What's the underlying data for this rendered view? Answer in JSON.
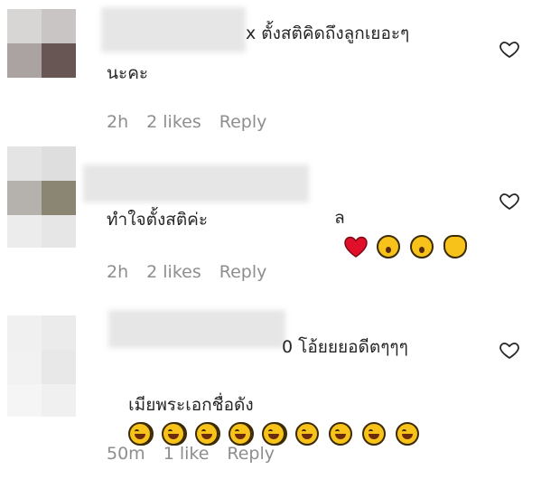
{
  "comments": [
    {
      "line1": "x ตั้งสติคิดถึงลูกเยอะๆ",
      "line2": "นะคะ",
      "time": "2h",
      "likes": "2 likes",
      "reply": "Reply"
    },
    {
      "line1_suffix": "ล",
      "line2": "ทำใจตั้งสติค่ะ",
      "time": "2h",
      "likes": "2 likes",
      "reply": "Reply"
    },
    {
      "line1": "0 โอ้ยยยอดีตๆๆๆ",
      "line2": "เมียพระเอกชื่อดัง",
      "time": "50m",
      "likes": "1 like",
      "reply": "Reply"
    }
  ],
  "icons": {
    "like": "heart-outline-icon",
    "emoji_laugh": "rolling-on-floor-laughing-emoji",
    "emoji_wow": "astonished-face-emoji",
    "emoji_heart": "red-heart-emoji",
    "emoji_clap": "waving-hand-emoji"
  },
  "colors": {
    "text": "#262626",
    "meta": "#8e8e8e",
    "heart_emoji": "#e0102a",
    "emoji_face": "#f7c21a"
  }
}
